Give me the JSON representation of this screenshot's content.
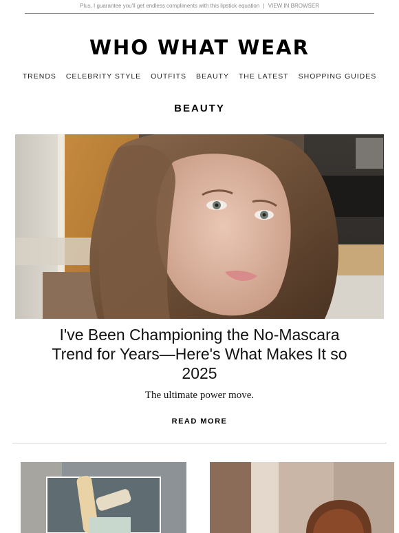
{
  "preheader": {
    "text": "Plus, I guarantee you'll get endless compliments with this lipstick equation",
    "separator": "|",
    "link": "VIEW IN BROWSER"
  },
  "logo": {
    "text": "WHO WHAT WEAR"
  },
  "nav": {
    "items": [
      {
        "label": "TRENDS"
      },
      {
        "label": "CELEBRITY STYLE"
      },
      {
        "label": "OUTFITS"
      },
      {
        "label": "BEAUTY"
      },
      {
        "label": "THE LATEST"
      },
      {
        "label": "SHOPPING GUIDES"
      }
    ]
  },
  "section": {
    "title": "BEAUTY"
  },
  "feature": {
    "headline": "I've Been Championing the No-Mascara Trend for Years—Here's What Makes It so 2025",
    "dek": "The ultimate power move.",
    "cta": "READ MORE"
  },
  "colors": {
    "text": "#111111",
    "muted": "#8a8a8a",
    "divider": "#d8d8d8"
  }
}
